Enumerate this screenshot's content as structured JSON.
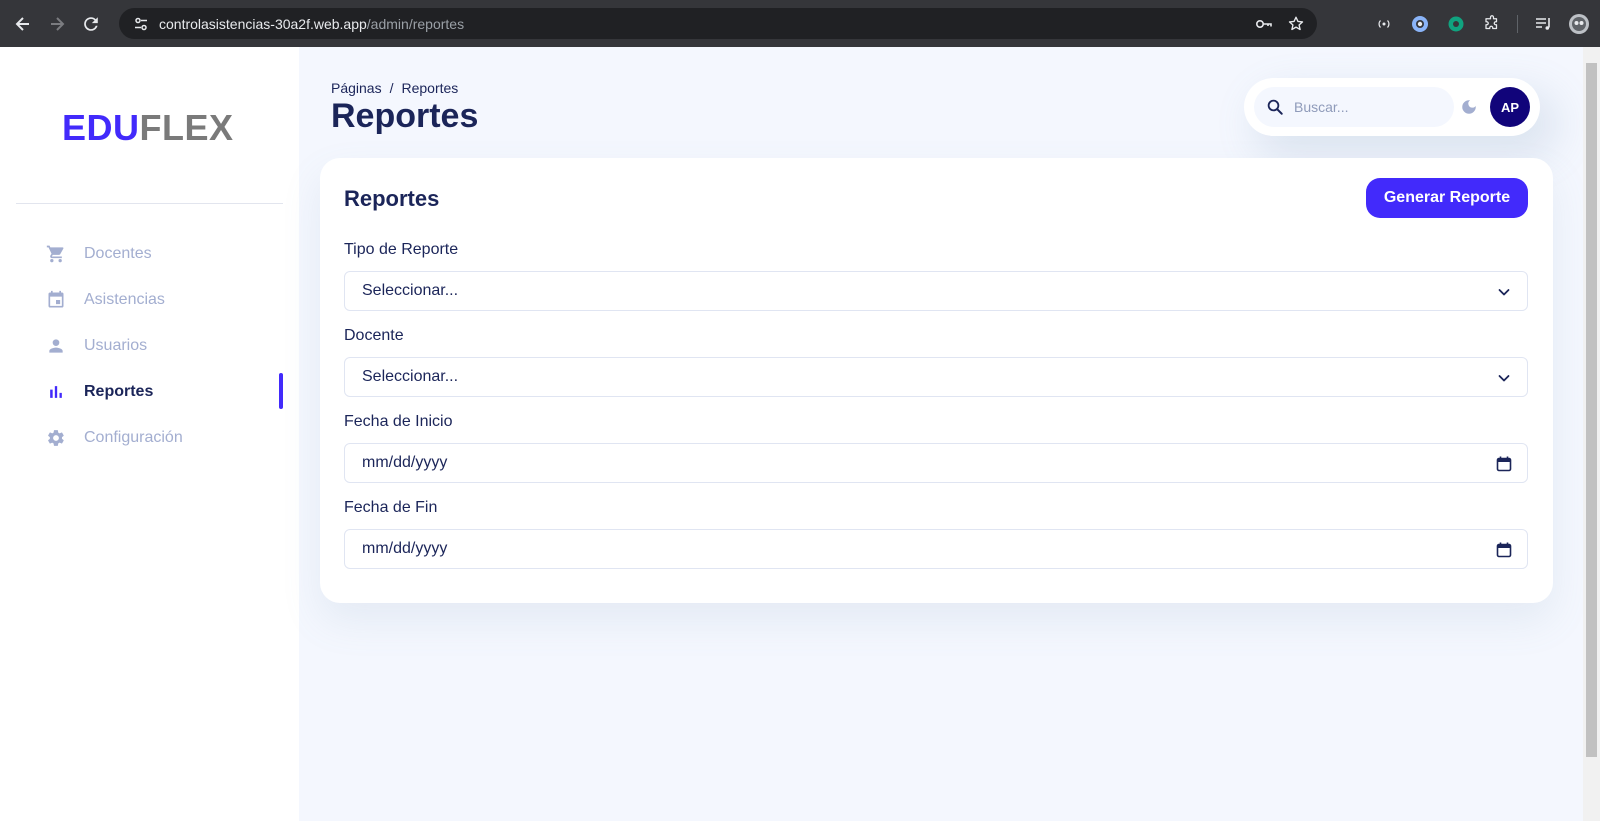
{
  "browser": {
    "url_host": "controlasistencias-30a2f.web.app",
    "url_path": "/admin/reportes",
    "icons": [
      "back-icon",
      "forward-icon",
      "reload-icon",
      "site-info-icon",
      "password-key-icon",
      "bookmark-star-icon",
      "extension-icons",
      "puzzle-icon",
      "media-icon",
      "profile-icon"
    ]
  },
  "sidebar": {
    "logo_primary": "EDU",
    "logo_secondary": "FLEX",
    "items": [
      {
        "label": "Docentes",
        "icon": "cart-icon",
        "active": false
      },
      {
        "label": "Asistencias",
        "icon": "calendar-icon",
        "active": false
      },
      {
        "label": "Usuarios",
        "icon": "person-icon",
        "active": false
      },
      {
        "label": "Reportes",
        "icon": "bar-chart-icon",
        "active": true
      },
      {
        "label": "Configuración",
        "icon": "gear-icon",
        "active": false
      }
    ]
  },
  "header": {
    "breadcrumb_root": "Páginas",
    "breadcrumb_separator": "/",
    "breadcrumb_current": "Reportes",
    "title": "Reportes",
    "search_placeholder": "Buscar...",
    "avatar_initials": "AP"
  },
  "card": {
    "title": "Reportes",
    "generate_button": "Generar Reporte",
    "fields": [
      {
        "label": "Tipo de Reporte",
        "value": "Seleccionar...",
        "kind": "select"
      },
      {
        "label": "Docente",
        "value": "Seleccionar...",
        "kind": "select"
      },
      {
        "label": "Fecha de Inicio",
        "value": "mm/dd/yyyy",
        "kind": "date"
      },
      {
        "label": "Fecha de Fin",
        "value": "mm/dd/yyyy",
        "kind": "date"
      }
    ]
  },
  "colors": {
    "accent": "#422afb",
    "text_dark": "#1b2559",
    "text_muted": "#a3aed0",
    "background": "#f4f7fe",
    "avatar": "#11047a"
  }
}
